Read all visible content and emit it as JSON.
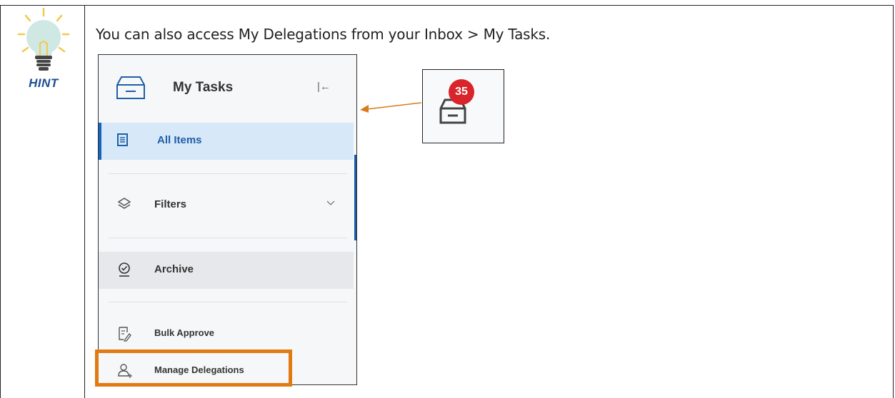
{
  "hint": {
    "label": "HINT"
  },
  "intro": "You can also access My Delegations from your Inbox > My Tasks.",
  "panel": {
    "title": "My Tasks",
    "items": [
      {
        "label": "All Items",
        "icon": "list-icon",
        "state": "active"
      },
      {
        "label": "Filters",
        "icon": "layers-icon",
        "expandable": true
      },
      {
        "label": "Archive",
        "icon": "check-circle-icon",
        "state": "hover"
      },
      {
        "label": "Bulk Approve",
        "icon": "edit-document-icon"
      },
      {
        "label": "Manage Delegations",
        "icon": "add-person-icon",
        "highlighted": true
      }
    ]
  },
  "inbox_badge": {
    "count": "35"
  },
  "colors": {
    "accent": "#1565c0",
    "highlight": "#e07b14",
    "badge": "#d8242a",
    "arrow": "#d97a1c"
  }
}
